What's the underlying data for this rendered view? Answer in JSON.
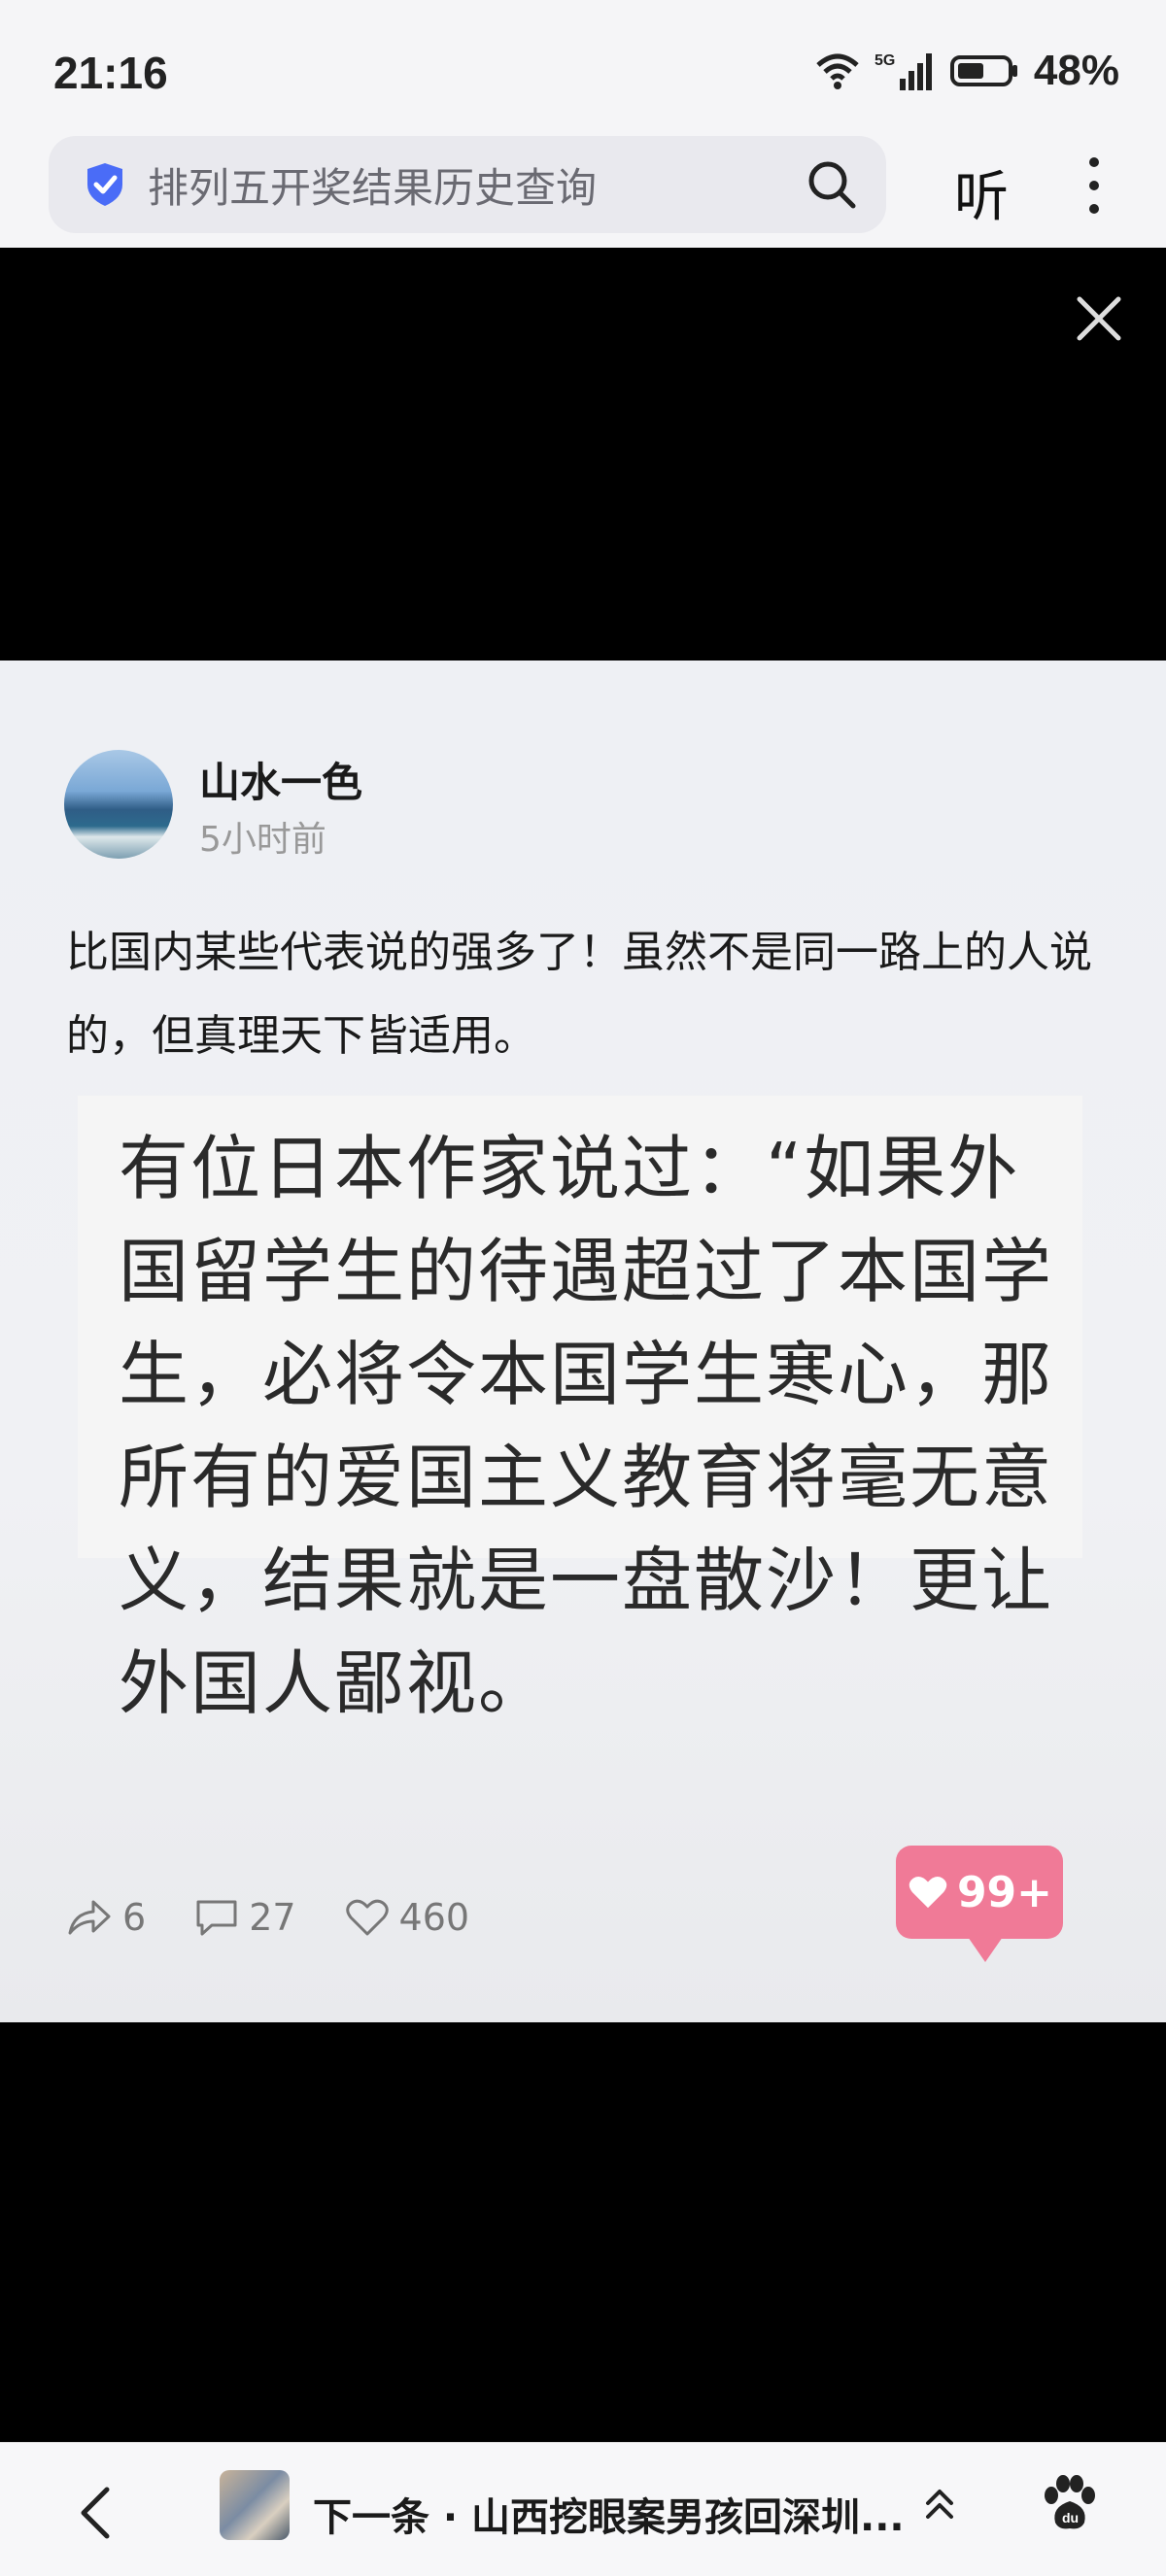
{
  "status_bar": {
    "time": "21:16",
    "network": "5G",
    "battery": "48%"
  },
  "search": {
    "query": "排列五开奖结果历史查询"
  },
  "toolbar": {
    "listen_label": "听"
  },
  "post": {
    "username": "山水一色",
    "time_ago": "5小时前",
    "text": "比国内某些代表说的强多了！虽然不是同一路上的人说的，但真理天下皆适用。",
    "quote": "有位日本作家说过：“如果外国留学生的待遇超过了本国学生，必将令本国学生寒心，那所有的爱国主义教育将毫无意义，结果就是一盘散沙！更让外国人鄙视。",
    "shares": "6",
    "comments": "27",
    "likes": "460",
    "like_badge": "99+"
  },
  "bottom_bar": {
    "next_label": "下一条 · 山西挖眼案男孩回深圳..."
  },
  "colors": {
    "accent_blue": "#4a6cf7",
    "like_pink": "#f07a97"
  }
}
